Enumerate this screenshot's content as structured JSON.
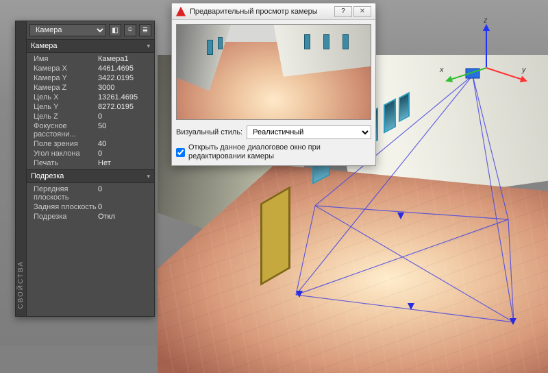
{
  "viewport": {
    "axis_labels": {
      "x": "x",
      "y": "y",
      "z": "z"
    }
  },
  "properties_panel": {
    "tab_label": "СВОЙСТВА",
    "selector_value": "Камера",
    "sections": {
      "camera": {
        "title": "Камера",
        "rows": [
          {
            "k": "Имя",
            "v": "Камера1"
          },
          {
            "k": "Камера X",
            "v": "4461.4695"
          },
          {
            "k": "Камера Y",
            "v": "3422.0195"
          },
          {
            "k": "Камера Z",
            "v": "3000"
          },
          {
            "k": "Цель X",
            "v": "13261.4695"
          },
          {
            "k": "Цель Y",
            "v": "8272.0195"
          },
          {
            "k": "Цель Z",
            "v": "0"
          },
          {
            "k": "Фокусное расстояни...",
            "v": "50"
          },
          {
            "k": "Поле зрения",
            "v": "40"
          },
          {
            "k": "Угол наклона",
            "v": "0"
          },
          {
            "k": "Печать",
            "v": "Нет"
          }
        ]
      },
      "clipping": {
        "title": "Подрезка",
        "rows": [
          {
            "k": "Передняя плоскость",
            "v": "0"
          },
          {
            "k": "Задняя плоскость",
            "v": "0"
          },
          {
            "k": "Подрезка",
            "v": "Откл"
          }
        ]
      }
    }
  },
  "camera_preview_dialog": {
    "title": "Предварительный просмотр камеры",
    "visual_style_label": "Визуальный стиль:",
    "visual_style_value": "Реалистичный",
    "checkbox_label": "Открыть данное диалоговое окно при редактировании камеры",
    "checkbox_checked": true
  }
}
